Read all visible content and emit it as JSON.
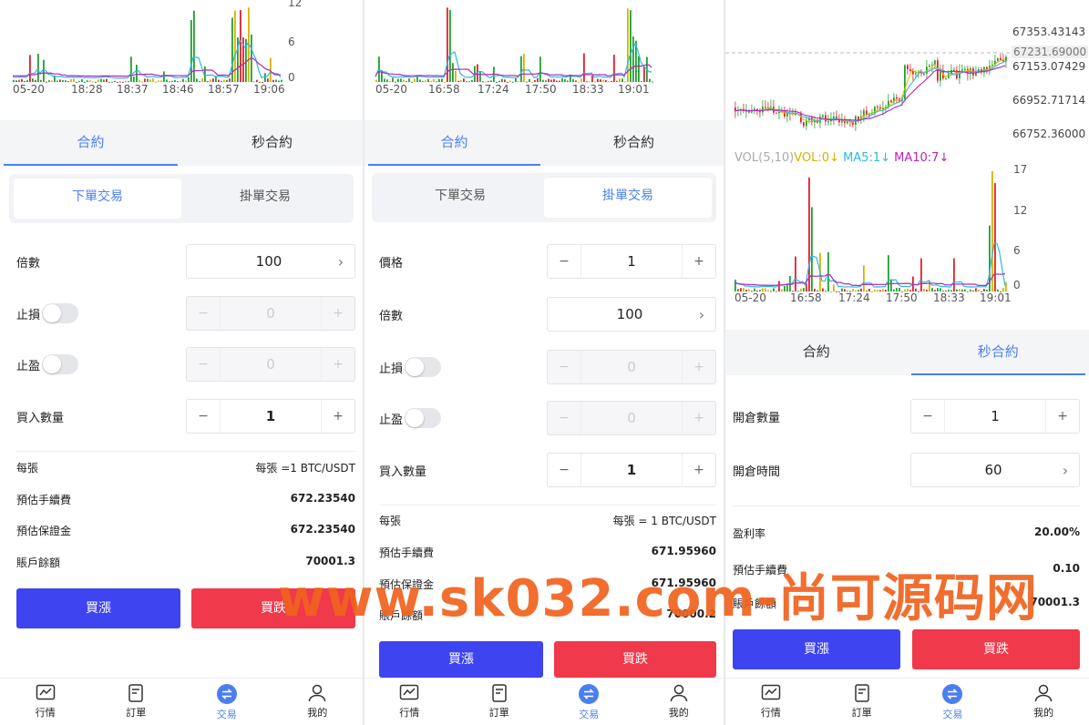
{
  "colors": {
    "accent": "#4a7ff0",
    "buy": "#3e44f0",
    "sell": "#f0394a",
    "up": "#1fa12e",
    "down": "#e0202e",
    "ma5": "#2db8e6",
    "ma10": "#b326b8",
    "vol": "#d7b300"
  },
  "panel1": {
    "chart": {
      "times": [
        "05-20",
        "18:28",
        "18:37",
        "18:46",
        "18:57",
        "19:06"
      ],
      "yticks": [
        "12",
        "6",
        "0"
      ]
    },
    "tabs": [
      "合約",
      "秒合約"
    ],
    "seg": [
      "下單交易",
      "掛單交易"
    ],
    "leverage": {
      "label": "倍數",
      "value": "100"
    },
    "stop_loss": {
      "label": "止損",
      "value": "0"
    },
    "take_profit": {
      "label": "止盈",
      "value": "0"
    },
    "quantity": {
      "label": "買入數量",
      "value": "1"
    },
    "info": [
      {
        "label": "每張",
        "value": "每張 =1 BTC/USDT"
      },
      {
        "label": "預估手續費",
        "value": "672.23540"
      },
      {
        "label": "預估保證金",
        "value": "672.23540"
      },
      {
        "label": "賬戶餘額",
        "value": "70001.3"
      }
    ],
    "buy": "買漲",
    "sell": "買跌"
  },
  "panel2": {
    "chart": {
      "times": [
        "05-20",
        "16:58",
        "17:24",
        "17:50",
        "18:33",
        "19:01"
      ]
    },
    "tabs": [
      "合約",
      "秒合約"
    ],
    "seg": [
      "下單交易",
      "掛單交易"
    ],
    "price": {
      "label": "價格",
      "value": "1"
    },
    "leverage": {
      "label": "倍數",
      "value": "100"
    },
    "stop_loss": {
      "label": "止損",
      "value": "0"
    },
    "take_profit": {
      "label": "止盈",
      "value": "0"
    },
    "quantity": {
      "label": "買入數量",
      "value": "1"
    },
    "info": [
      {
        "label": "每張",
        "value": "每張 = 1 BTC/USDT"
      },
      {
        "label": "預估手續費",
        "value": "671.95960"
      },
      {
        "label": "預估保證金",
        "value": "671.95960"
      },
      {
        "label": "賬戶餘額",
        "value": "70000.2"
      }
    ],
    "buy": "買漲",
    "sell": "買跌"
  },
  "panel3": {
    "price_axis": [
      "67353.43143",
      "67153.07429",
      "66952.71714",
      "66752.36000"
    ],
    "current_price": "67231.69000",
    "vol_legend": {
      "vol": "VOL(5,10)",
      "vol_v": "VOL:0↓",
      "ma5": "MA5:1↓",
      "ma10": "MA10:7↓"
    },
    "vol_yticks": [
      "17",
      "12",
      "6",
      "0"
    ],
    "times": [
      "05-20",
      "16:58",
      "17:24",
      "17:50",
      "18:33",
      "19:01"
    ],
    "tabs": [
      "合約",
      "秒合約"
    ],
    "open_qty": {
      "label": "開倉數量",
      "value": "1"
    },
    "open_time": {
      "label": "開倉時間",
      "value": "60"
    },
    "info": [
      {
        "label": "盈利率",
        "value": "20.00%"
      },
      {
        "label": "預估手續費",
        "value": "0.10"
      },
      {
        "label": "賬戶餘額",
        "value": "70001.3"
      }
    ],
    "buy": "買漲",
    "sell": "買跌"
  },
  "nav": [
    "行情",
    "訂單",
    "交易",
    "我的"
  ],
  "watermark": "www.sk032.com-尚可源码网"
}
